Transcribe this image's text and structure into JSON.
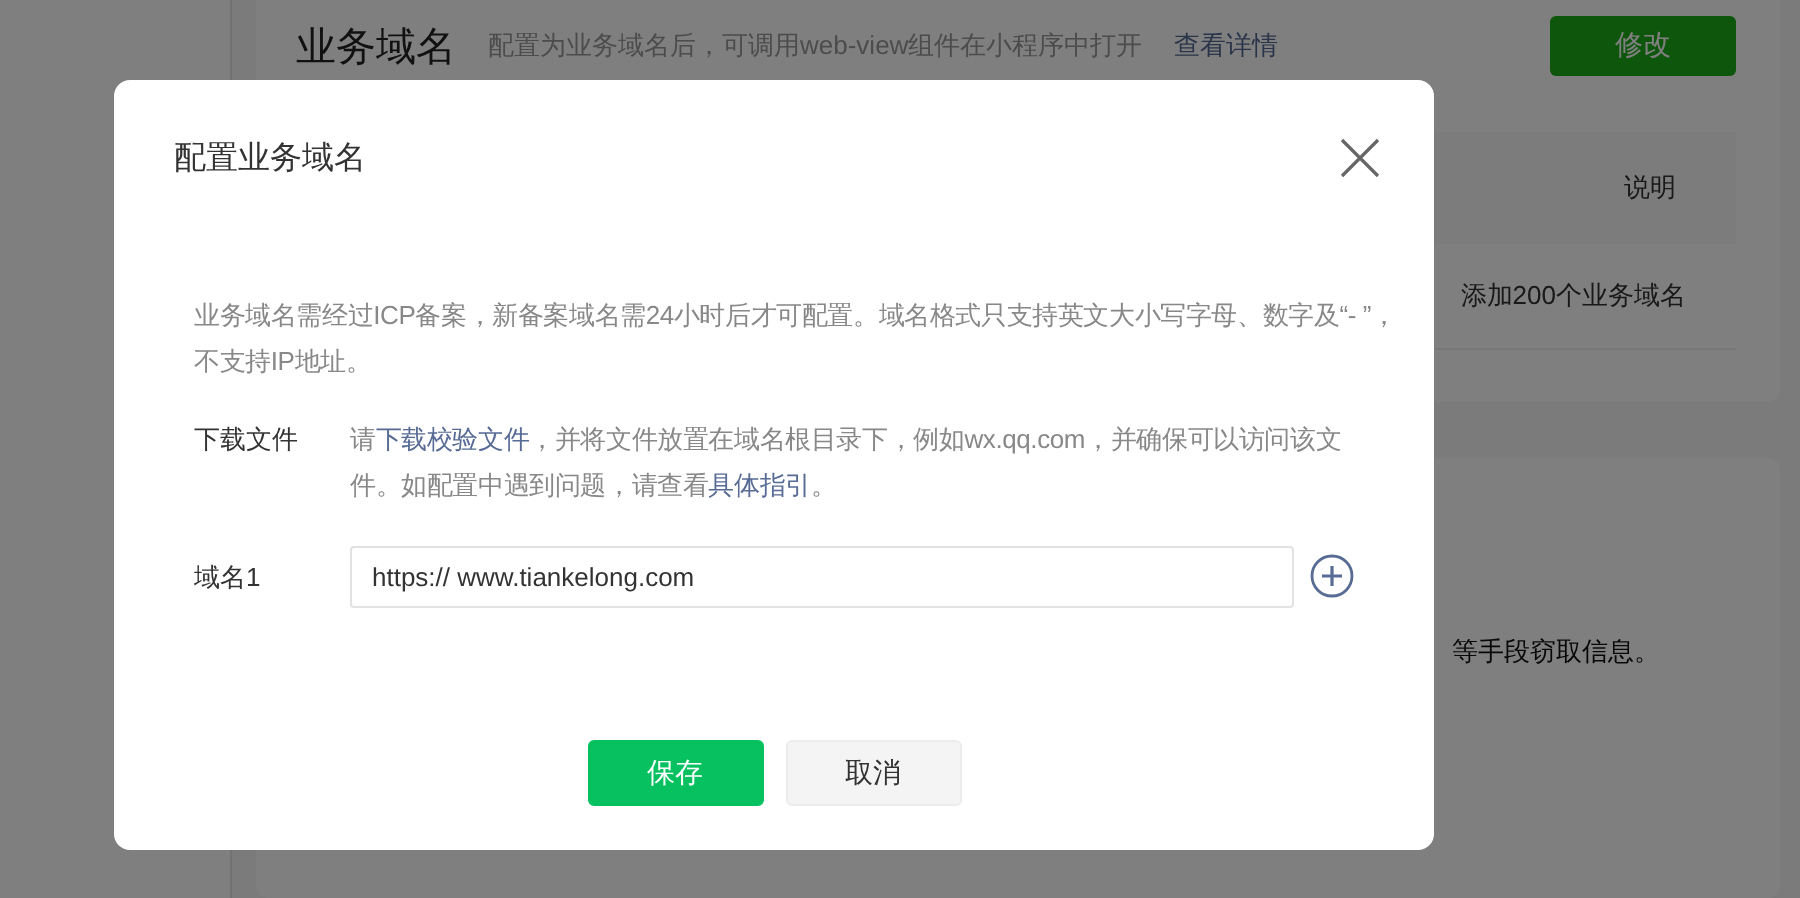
{
  "page": {
    "title": "业务域名",
    "description": "配置为业务域名后，可调用web-view组件在小程序中打开",
    "details_link": "查看详情",
    "edit_button": "修改",
    "table_header": "说明",
    "table_row": "添加200个业务域名",
    "notice_fragment": "等手段窃取信息。"
  },
  "dialog": {
    "title": "配置业务域名",
    "notice": "业务域名需经过ICP备案，新备案域名需24小时后才可配置。域名格式只支持英文大小写字母、数字及“- ”，不支持IP地址。",
    "download": {
      "label": "下载文件",
      "parts": [
        {
          "kind": "text",
          "text": "请"
        },
        {
          "kind": "link",
          "text": "下载校验文件"
        },
        {
          "kind": "text",
          "text": "，并将文件放置在域名根目录下，例如wx.qq.com，并确保可以访问该文件。如配置中遇到问题，请查看"
        },
        {
          "kind": "link",
          "text": "具体指引"
        },
        {
          "kind": "text",
          "text": "。"
        }
      ]
    },
    "domains": [
      {
        "label": "域名1",
        "value": "https:// www.tiankelong.com"
      }
    ],
    "buttons": [
      {
        "kind": "primary",
        "label": "保存"
      },
      {
        "kind": "secondary",
        "label": "取消"
      }
    ]
  }
}
